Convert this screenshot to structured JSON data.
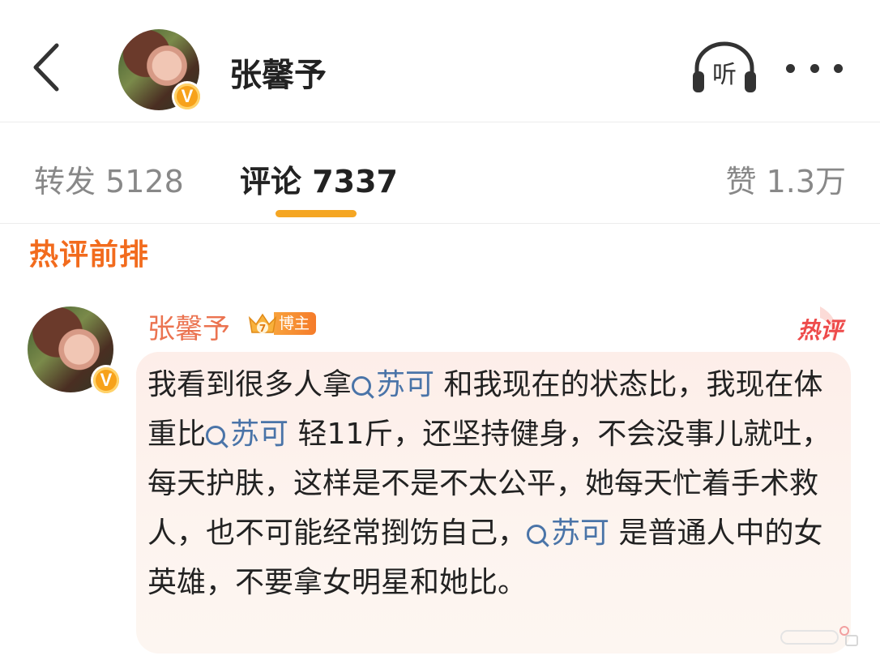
{
  "header": {
    "title": "张馨予",
    "listen_label": "听"
  },
  "tabs": [
    {
      "label": "转发 5128"
    },
    {
      "label": "评论 7337"
    },
    {
      "label": "赞 1.3万"
    }
  ],
  "section_title": "热评前排",
  "comment": {
    "author": "张馨予",
    "role_badge": "博主",
    "level": "7",
    "hot_tag": "热评",
    "text_parts": [
      "我看到很多人拿",
      "苏可",
      " 和我现在的状态比，我现在体重比",
      "苏可",
      " 轻11斤，还坚持健身，不会没事儿就吐，每天护肤，这样是不是不太公平，她每天忙着手术救人，也不可能经常捯饬自己，",
      "苏可",
      " 是普通人中的女英雄，不要拿女明星和她比。"
    ]
  },
  "colors": {
    "accent_orange": "#f5a623",
    "author_color": "#eb7350",
    "mention_blue": "#4a74a8",
    "hot_red": "#ee4b4b"
  }
}
